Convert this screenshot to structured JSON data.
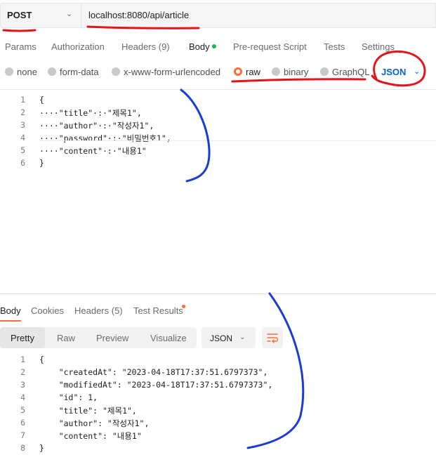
{
  "request": {
    "method": "POST",
    "url": "localhost:8080/api/article"
  },
  "request_tabs": [
    "Params",
    "Authorization",
    "Headers (9)",
    "Body",
    "Pre-request Script",
    "Tests",
    "Settings"
  ],
  "body_types": [
    "none",
    "form-data",
    "x-www-form-urlencoded",
    "raw",
    "binary",
    "GraphQL"
  ],
  "body_format": "JSON",
  "request_body": {
    "line_numbers": [
      "1",
      "2",
      "3",
      "4",
      "5",
      "6"
    ],
    "lines": [
      "{",
      "····\"title\"·:·\"제목1\",",
      "····\"author\"·:·\"작성자1\",",
      "····\"password\"·:·\"비밀번호1\",",
      "····\"content\"·:·\"내용1\"",
      "}"
    ]
  },
  "response_tabs": [
    "Body",
    "Cookies",
    "Headers (5)",
    "Test Results"
  ],
  "response_views": [
    "Pretty",
    "Raw",
    "Preview",
    "Visualize"
  ],
  "response_format": "JSON",
  "response_body": {
    "line_numbers": [
      "1",
      "2",
      "3",
      "4",
      "5",
      "6",
      "7",
      "8"
    ],
    "lines": [
      "{",
      "    \"createdAt\": \"2023-04-18T17:37:51.6797373\",",
      "    \"modifiedAt\": \"2023-04-18T17:37:51.6797373\",",
      "    \"id\": 1,",
      "    \"title\": \"제목1\",",
      "    \"author\": \"작성자1\",",
      "    \"content\": \"내용1\"",
      "}"
    ]
  },
  "colors": {
    "accent": "#ff6c37",
    "json_blue": "#0265d2",
    "annotation_red": "#e4141b",
    "annotation_blue": "#1a3cd6",
    "success_green": "#0cbb52"
  },
  "icons": {
    "method_dropdown": "chevron-down-icon",
    "format_dropdown": "chevron-down-icon",
    "wrap": "wrap-lines-icon"
  }
}
